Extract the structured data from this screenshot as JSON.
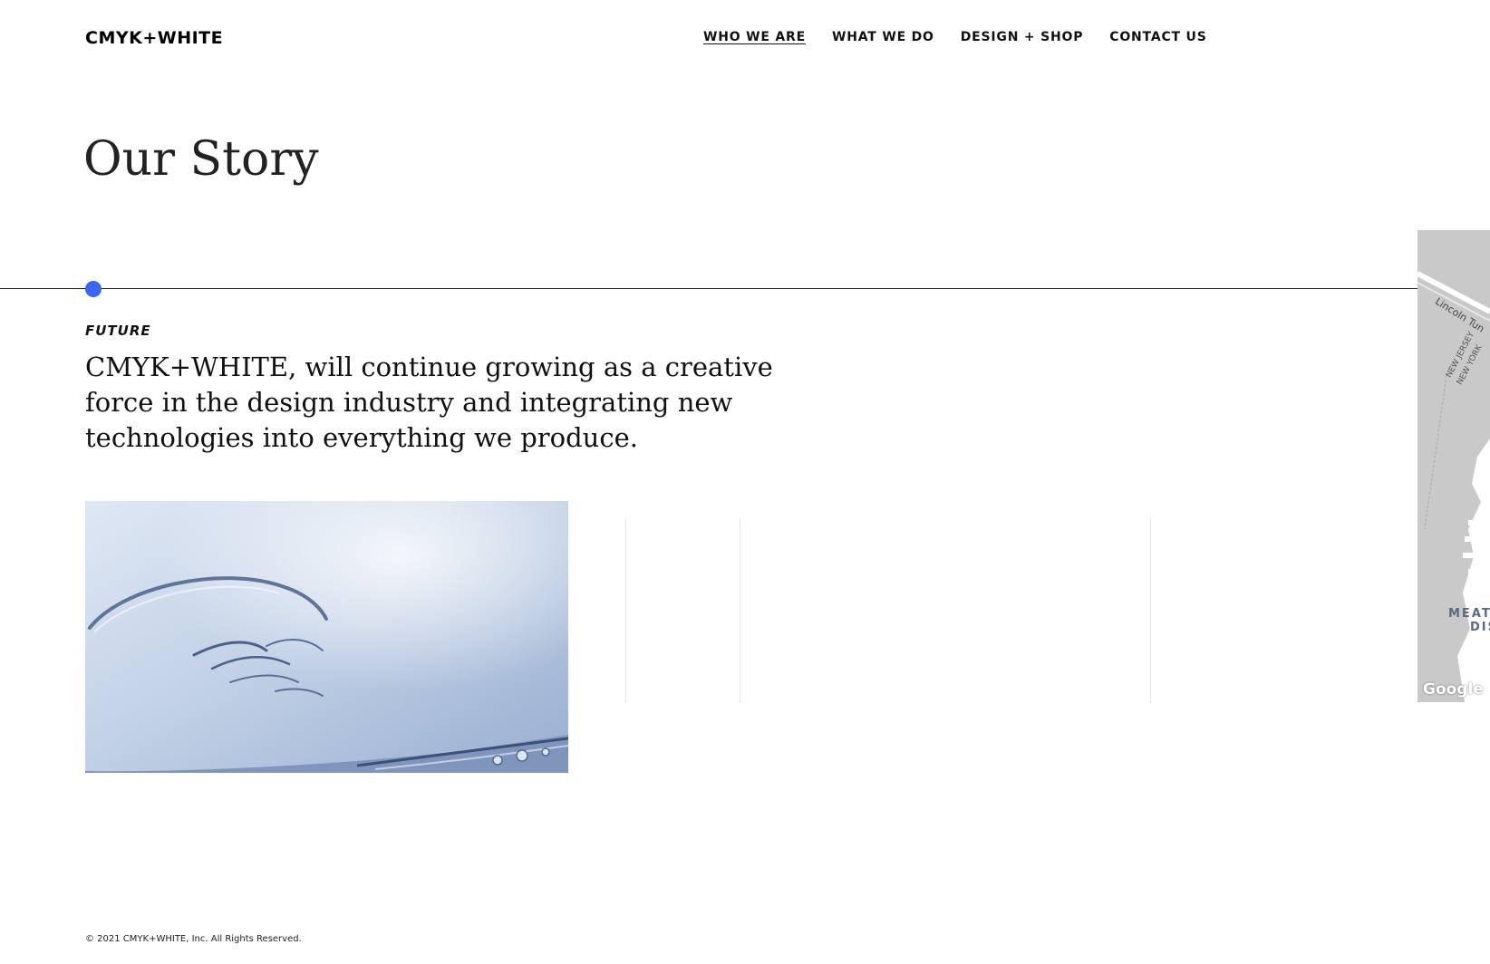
{
  "header": {
    "logo": "CMYK+WHITE",
    "nav": [
      "WHO WE ARE",
      "WHAT WE DO",
      "DESIGN + SHOP",
      "CONTACT US"
    ]
  },
  "page": {
    "title": "Our Story"
  },
  "timeline": {
    "era_label": "FUTURE",
    "text": "CMYK+WHITE, will continue growing as a creative force in the design industry and integrating new technologies into everything we produce."
  },
  "map": {
    "google_logo": "Google",
    "tunnel_label": "Lincoln Tun",
    "state_label_nj": "NEW JERSEY",
    "state_label_ny": "NEW YORK",
    "district_label_1": "MEAT",
    "district_label_2": "DIS"
  },
  "footer": {
    "copyright": "© 2021 CMYK+WHITE, Inc. All Rights Reserved."
  },
  "colors": {
    "accent_dot": "#3b66f0",
    "map_background": "#c9c9c9"
  }
}
